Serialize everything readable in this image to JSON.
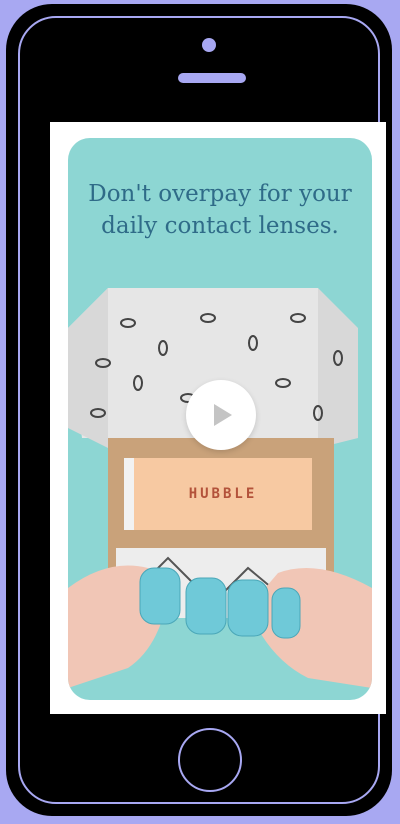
{
  "ad": {
    "headline": "Don't overpay for your daily contact lenses.",
    "brand": "HUBBLE",
    "media_icon": "play-icon"
  },
  "colors": {
    "frame_accent": "#a8a8f2",
    "card_background": "#8dd6d3",
    "headline": "#2f6b88",
    "brand_band": "#f7c9a2",
    "brand_text": "#b3523a"
  }
}
